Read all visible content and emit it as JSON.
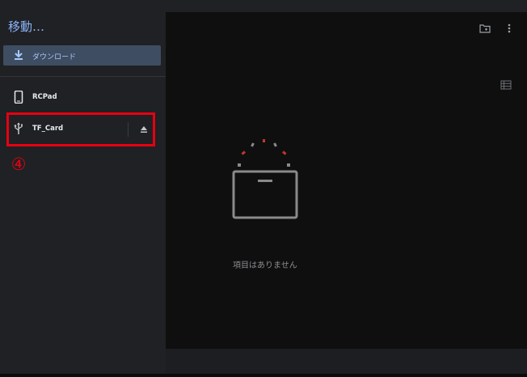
{
  "app": {
    "title": "移動…"
  },
  "sidebar": {
    "downloads_label": "ダウンロード",
    "roots": [
      {
        "label": "RCPad",
        "icon": "phone-icon"
      },
      {
        "label": "TF_Card",
        "icon": "usb-icon"
      }
    ]
  },
  "annotation": {
    "step_marker": "④",
    "color": "#e60012"
  },
  "main": {
    "empty_message": "項目はありません"
  },
  "icons": [
    "download-icon",
    "phone-icon",
    "usb-icon",
    "eject-icon",
    "new-folder-icon",
    "more-vert-icon",
    "list-view-icon"
  ],
  "colors": {
    "accent": "#8ab4f8",
    "selected_bg": "#3f4d62",
    "highlight": "#e60012"
  }
}
